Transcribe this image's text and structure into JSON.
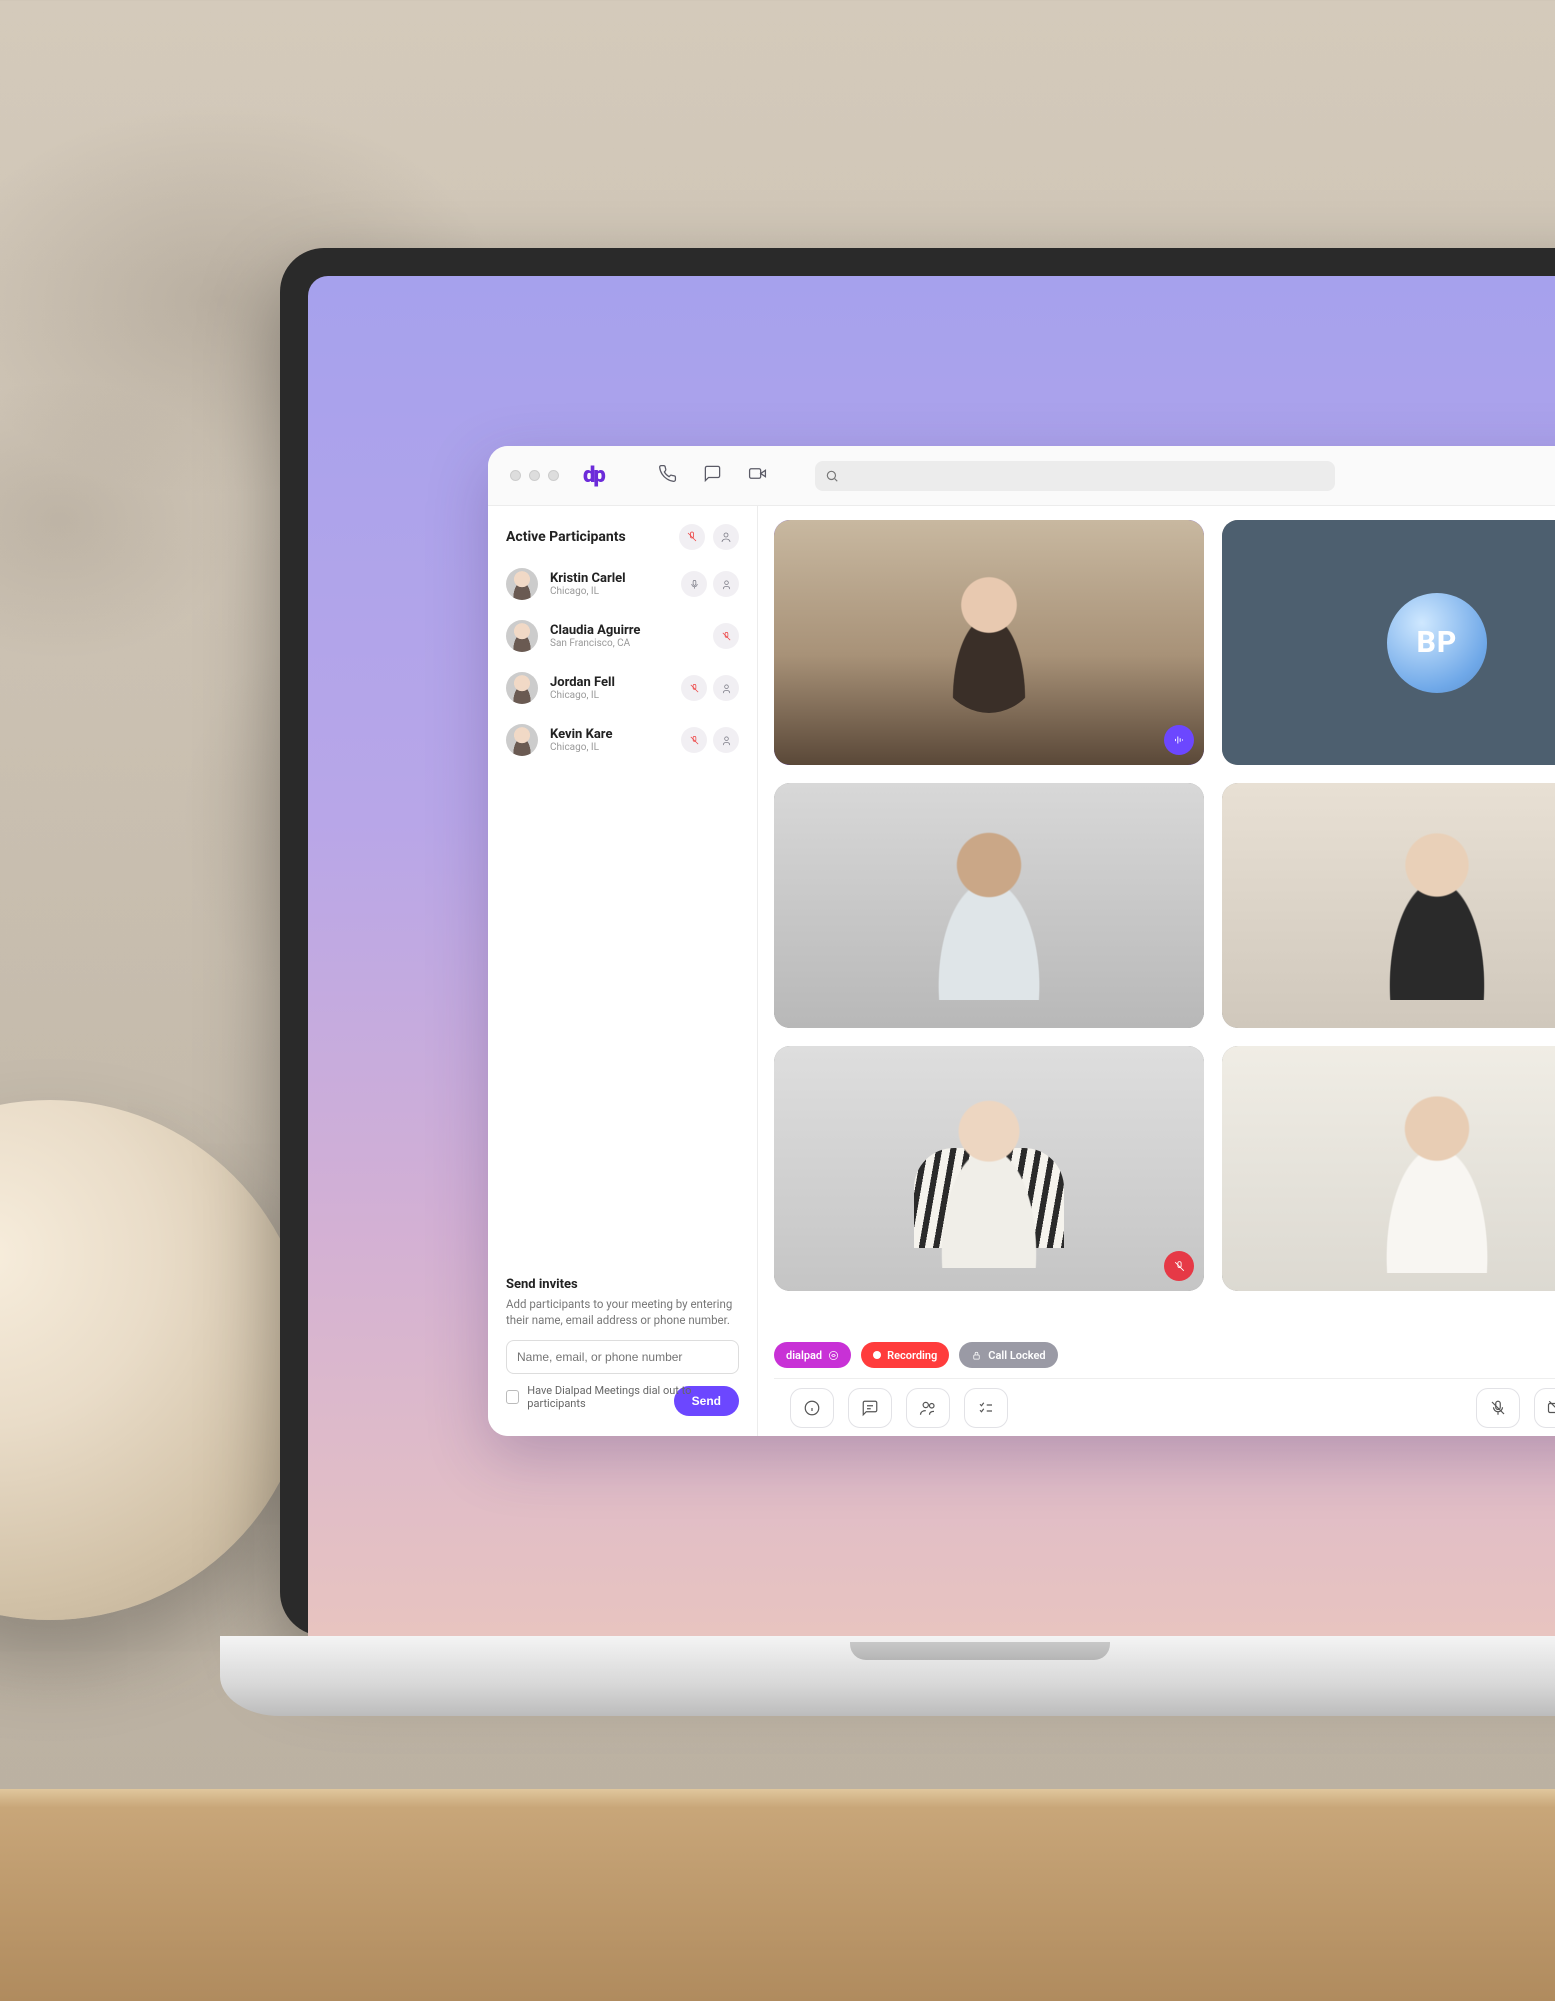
{
  "search": {
    "placeholder": ""
  },
  "sidebar": {
    "title": "Active Participants",
    "participants": [
      {
        "name": "Kristin Carlel",
        "location": "Chicago, IL",
        "mic": "on",
        "person": "on"
      },
      {
        "name": "Claudia Aguirre",
        "location": "San Francisco, CA",
        "mic": "muted",
        "person": "none"
      },
      {
        "name": "Jordan Fell",
        "location": "Chicago, IL",
        "mic": "muted",
        "person": "on"
      },
      {
        "name": "Kevin Kare",
        "location": "Chicago, IL",
        "mic": "muted",
        "person": "on"
      }
    ],
    "invites": {
      "title": "Send invites",
      "description": "Add participants to your meeting by entering their name, email address or phone number.",
      "placeholder": "Name, email, or phone number",
      "checkbox_label": "Have Dialpad Meetings dial out to participants",
      "send_label": "Send"
    }
  },
  "video": {
    "avatar_initials": "BP"
  },
  "status": {
    "brand_label": "dialpad",
    "recording_label": "Recording",
    "lock_label": "Call Locked"
  }
}
